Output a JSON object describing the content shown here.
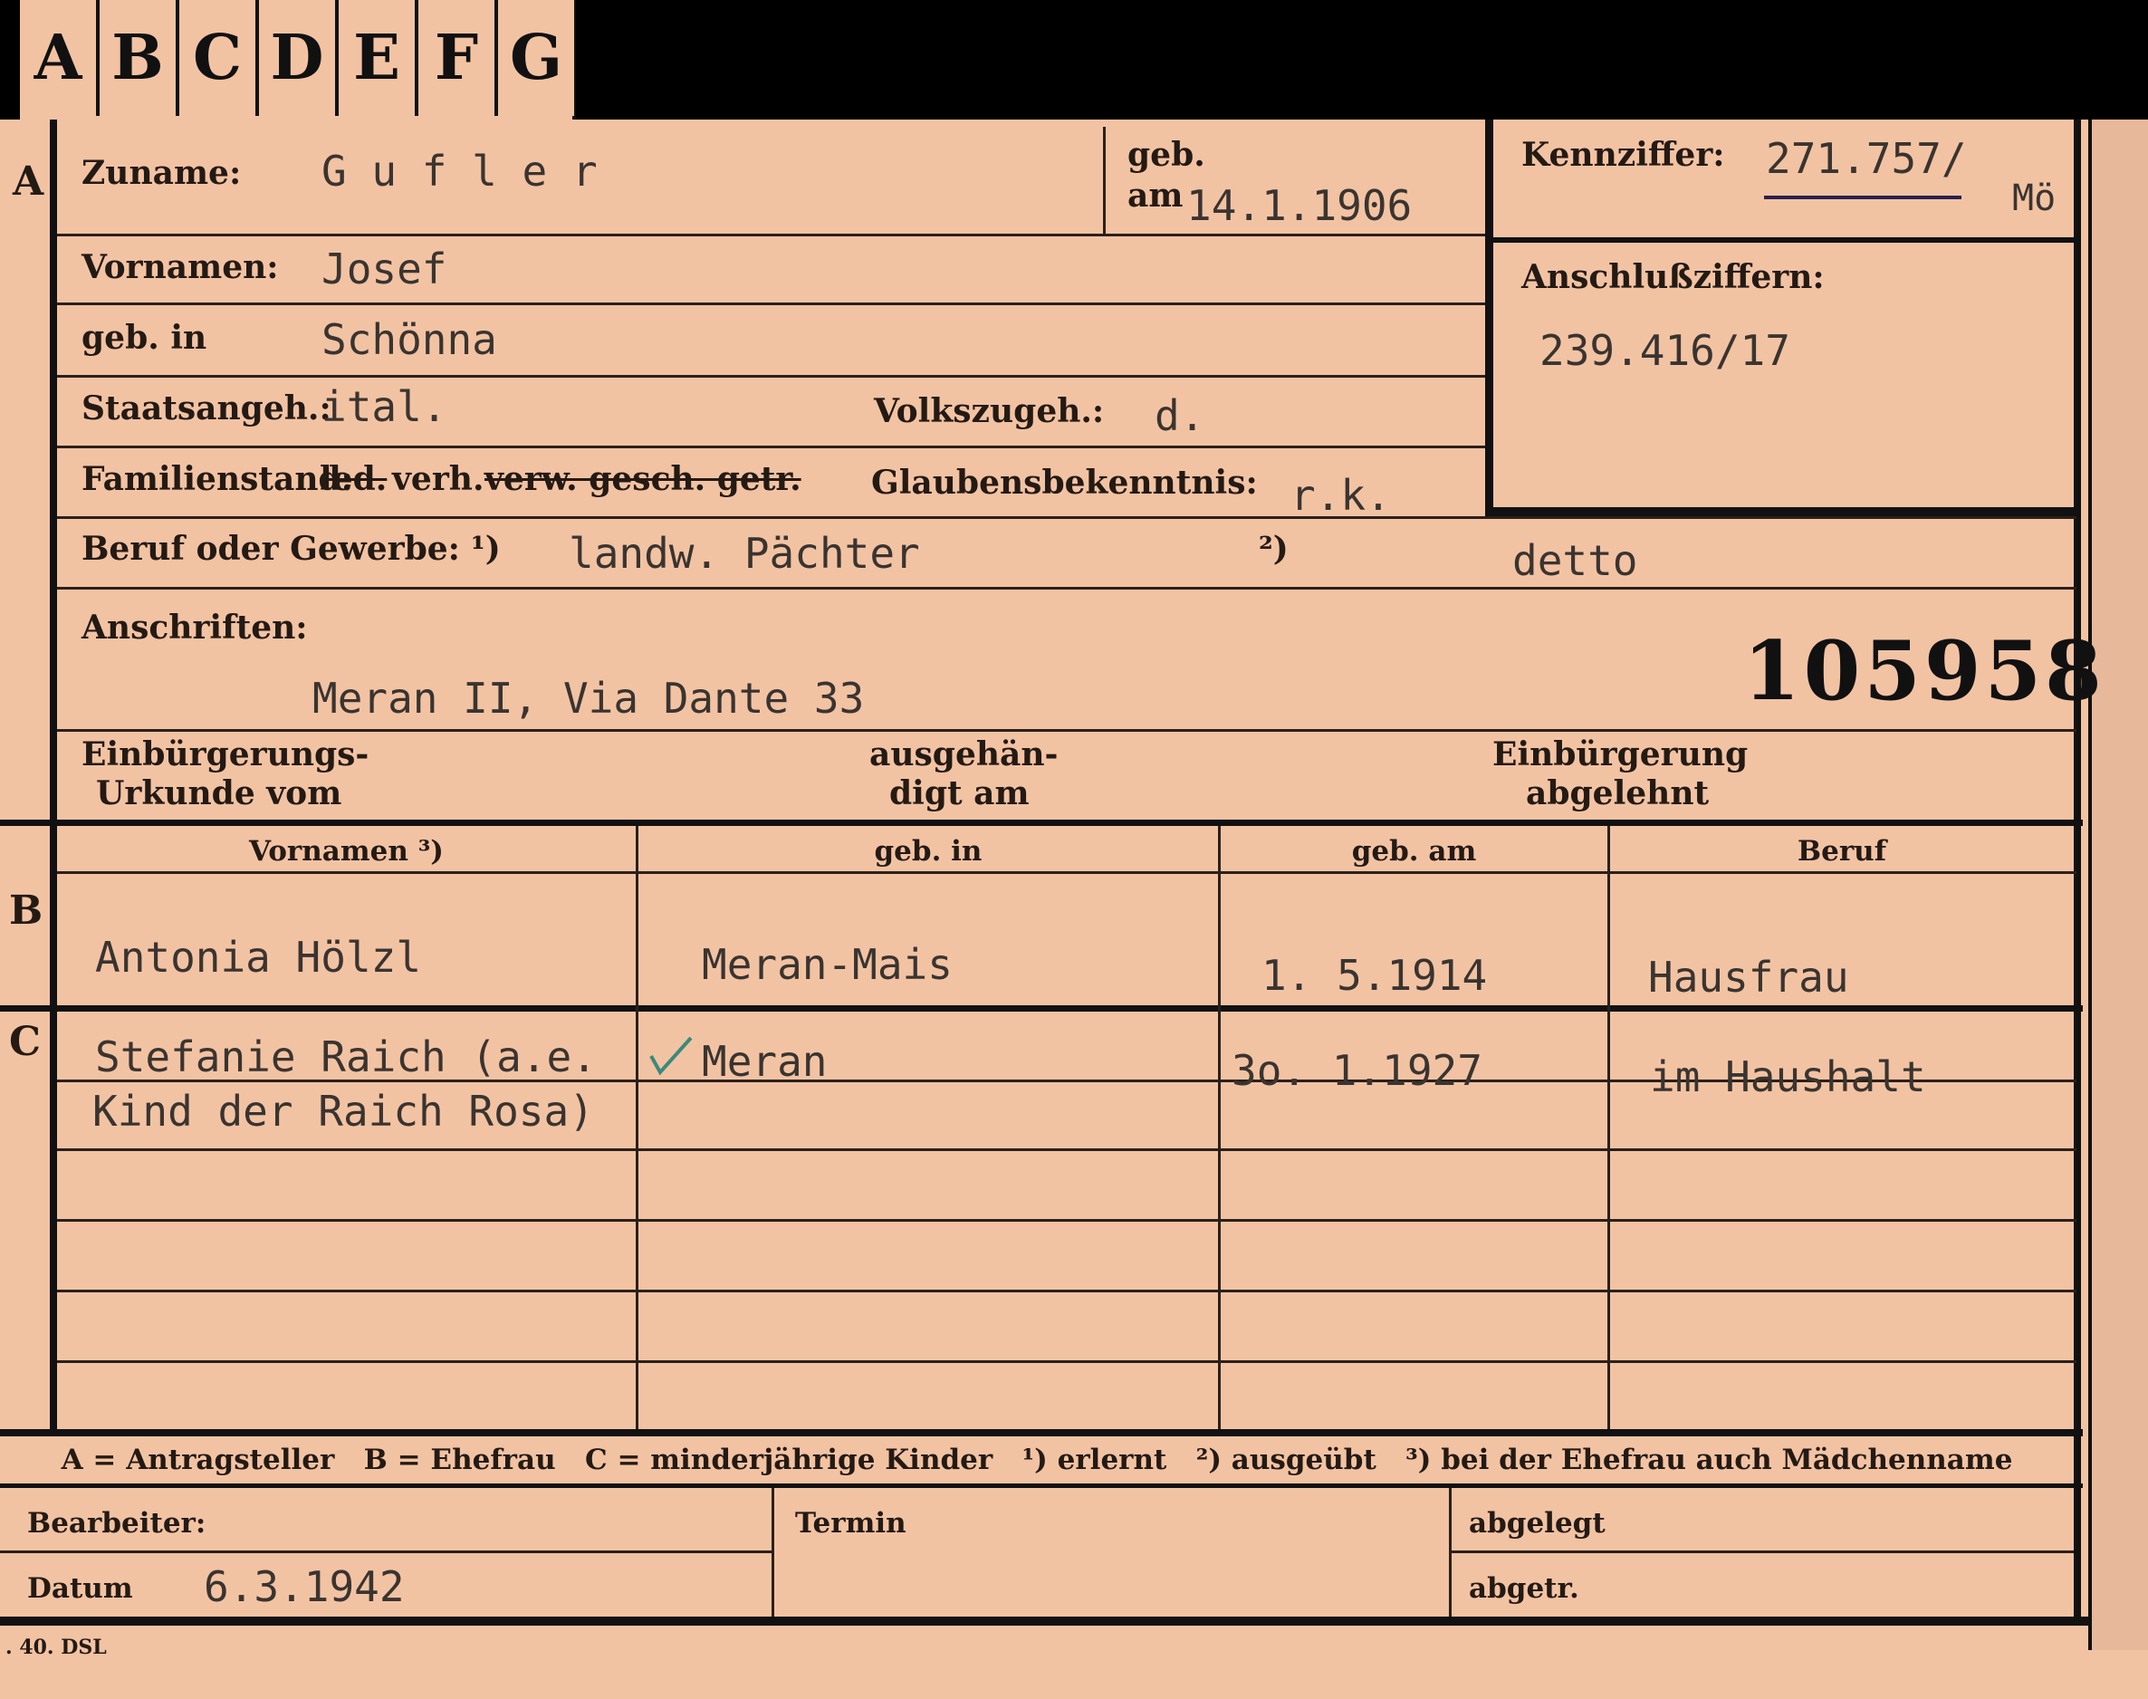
{
  "tabs": [
    "A",
    "B",
    "C",
    "D",
    "E",
    "F",
    "G"
  ],
  "section_markers": {
    "a": "A",
    "b": "B",
    "c": "C"
  },
  "header": {
    "zuname_label": "Zuname:",
    "zuname_value": "G u f l e r",
    "geb_label": "geb.",
    "am_label": "am",
    "geb_am_value": "14.1.1906",
    "kennziffer_label": "Kennziffer:",
    "kennziffer_value": "271.757/",
    "kennziffer_suffix": "Mö",
    "vornamen_label": "Vornamen:",
    "vornamen_value": "Josef",
    "geb_in_label": "geb. in",
    "geb_in_value": "Schönna",
    "anschluss_label": "Anschlußziffern:",
    "anschluss_value": "239.416/17",
    "staatsangeh_label": "Staatsangeh.:",
    "staatsangeh_value": "ital.",
    "volkszugeh_label": "Volkszugeh.:",
    "volkszugeh_value": "d.",
    "familienstand_label": "Familienstand:",
    "fam_led": "led.",
    "fam_verh": "verh.",
    "fam_rest": "verw. gesch. getr.",
    "glaubens_label": "Glaubensbekenntnis:",
    "glaubens_value": "r.k.",
    "beruf_label": "Beruf oder Gewerbe:",
    "beruf_mark1": "¹)",
    "beruf_value1": "landw. Pächter",
    "beruf_mark2": "²)",
    "beruf_value2": "detto",
    "anschriften_label": "Anschriften:",
    "anschriften_value": "Meran II, Via Dante 33",
    "card_number": "105958",
    "einb_urkunde_l1": "Einbürgerungs-",
    "einb_urkunde_l2": "Urkunde vom",
    "ausgeh_l1": "ausgehän-",
    "ausgeh_l2": "digt am",
    "einb_abgelehnt_l1": "Einbürgerung",
    "einb_abgelehnt_l2": "abgelehnt"
  },
  "table": {
    "headers": [
      "Vornamen ³)",
      "geb. in",
      "geb. am",
      "Beruf"
    ],
    "spouse": {
      "vornamen": "Antonia Hölzl",
      "geb_in": "Meran-Mais",
      "geb_am": "1. 5.1914",
      "beruf": "Hausfrau"
    },
    "child": {
      "vornamen_l1": "Stefanie Raich (a.e.",
      "vornamen_l2": "Kind der Raich Rosa)",
      "geb_in": "Meran",
      "geb_am": "3o. 1.1927",
      "beruf": "im Haushalt"
    }
  },
  "legend": "A = Antragsteller   B = Ehefrau   C = minderjährige Kinder   ¹) erlernt   ²) ausgeübt   ³) bei der Ehefrau auch Mädchenname",
  "footer": {
    "bearbeiter_label": "Bearbeiter:",
    "datum_label": "Datum",
    "datum_value": "6.3.1942",
    "termin_label": "Termin",
    "abgelegt_label": "abgelegt",
    "abgetr_label": "abgetr."
  },
  "print_mark": ". 40. DSL"
}
